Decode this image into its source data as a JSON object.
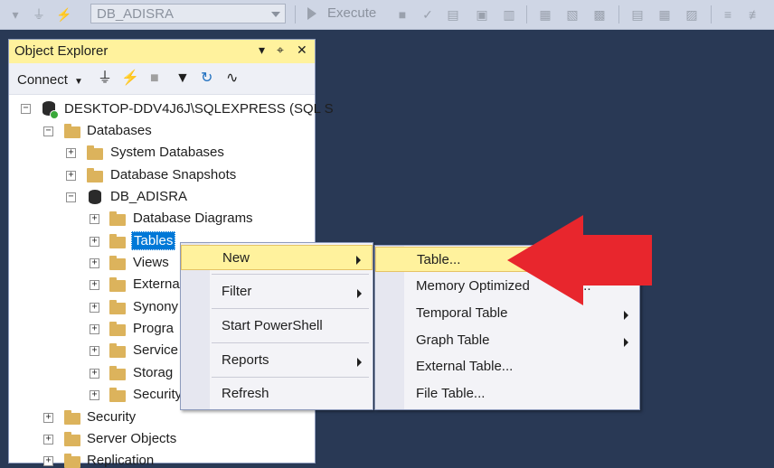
{
  "toolbar": {
    "database_value": "DB_ADISRA",
    "execute_label": "Execute"
  },
  "object_explorer": {
    "title": "Object Explorer",
    "pin_symbol": "▾",
    "pin2_symbol": "⌖",
    "close_symbol": "✕",
    "connect_label": "Connect",
    "tree": {
      "server": "DESKTOP-DDV4J6J\\SQLEXPRESS (SQL S",
      "databases": "Databases",
      "system_databases": "System Databases",
      "database_snapshots": "Database Snapshots",
      "db": "DB_ADISRA",
      "db_children": [
        "Database Diagrams",
        "Tables",
        "Views",
        "Externa",
        "Synony",
        "Progra",
        "Service",
        "Storag",
        "Security"
      ],
      "security": "Security",
      "server_objects": "Server Objects",
      "replication": "Replication"
    },
    "expander_plus": "+",
    "expander_minus": "−"
  },
  "context_menu": {
    "items": [
      "New",
      "Filter",
      "Start PowerShell",
      "Reports",
      "Refresh"
    ]
  },
  "submenu": {
    "items": [
      "Table...",
      "Memory Optimized",
      "Temporal Table",
      "Graph Table",
      "External Table...",
      "File Table..."
    ],
    "memory_suffix": "..."
  },
  "colors": {
    "background": "#293955",
    "highlight": "#fff29d",
    "arrow": "#e8262d"
  }
}
